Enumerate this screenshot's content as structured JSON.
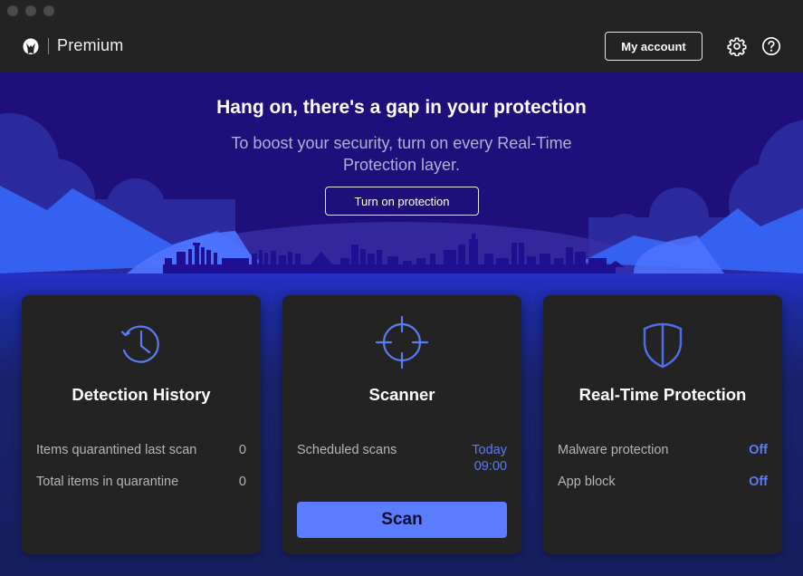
{
  "window": {
    "traffic_lights": [
      "close",
      "minimize",
      "zoom"
    ]
  },
  "header": {
    "logo_icon": "malwarebytes-logo-icon",
    "product_name": "Premium",
    "account_button": "My account",
    "settings_icon": "gear-icon",
    "help_icon": "question-circle-icon"
  },
  "hero": {
    "title": "Hang on, there's a gap in your protection",
    "subtitle": "To boost your security, turn on every Real-Time Protection layer.",
    "button": "Turn on protection"
  },
  "cards": {
    "detection_history": {
      "icon": "clock-history-icon",
      "title": "Detection History",
      "rows": [
        {
          "label": "Items quarantined last scan",
          "value": "0"
        },
        {
          "label": "Total items in quarantine",
          "value": "0"
        }
      ]
    },
    "scanner": {
      "icon": "crosshair-icon",
      "title": "Scanner",
      "rows": [
        {
          "label": "Scheduled scans",
          "value_line1": "Today",
          "value_line2": "09:00"
        }
      ],
      "scan_button": "Scan"
    },
    "real_time_protection": {
      "icon": "shield-icon",
      "title": "Real-Time Protection",
      "rows": [
        {
          "label": "Malware protection",
          "value": "Off"
        },
        {
          "label": "App block",
          "value": "Off"
        }
      ]
    }
  },
  "colors": {
    "accent_blue": "#5b7cff",
    "status_blue": "#5b7cf4",
    "hero_bg": "#1e0f7a",
    "card_bg": "#232323",
    "titlebar_bg": "#232323"
  }
}
